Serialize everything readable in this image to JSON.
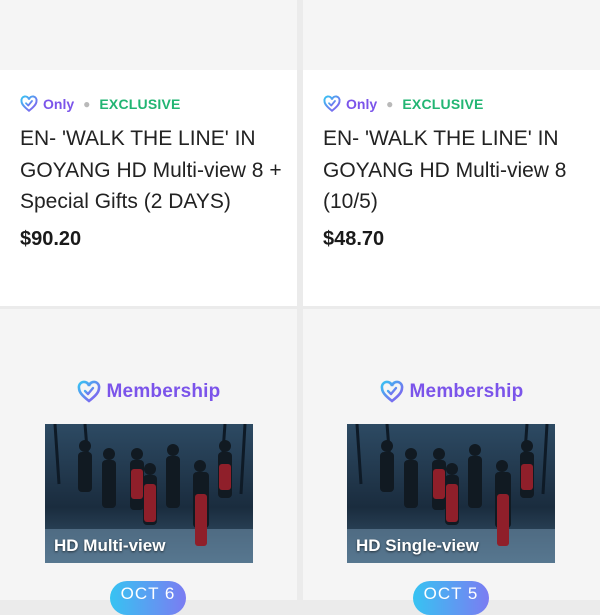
{
  "products": [
    {
      "only_label": "Only",
      "exclusive_label": "EXCLUSIVE",
      "title": "EN- 'WALK THE LINE' IN GOYANG HD Multi-view 8 + Special Gifts (2 DAYS)",
      "price": "$90.20"
    },
    {
      "only_label": "Only",
      "exclusive_label": "EXCLUSIVE",
      "title": "EN- 'WALK THE LINE' IN GOYANG HD Multi-view 8 (10/5)",
      "price": "$48.70"
    }
  ],
  "posters": [
    {
      "membership_label": "Membership",
      "image_label": "HD Multi-view",
      "date_label": "OCT 6"
    },
    {
      "membership_label": "Membership",
      "image_label": "HD Single-view",
      "date_label": "OCT 5"
    }
  ],
  "colors": {
    "accent_purple": "#7b54ea",
    "exclusive_green": "#22b573",
    "pill_gradient_start": "#37c3f2",
    "pill_gradient_end": "#7b7cf2"
  },
  "icons": {
    "only_icon": "heart-check-icon",
    "membership_icon": "heart-check-icon"
  }
}
